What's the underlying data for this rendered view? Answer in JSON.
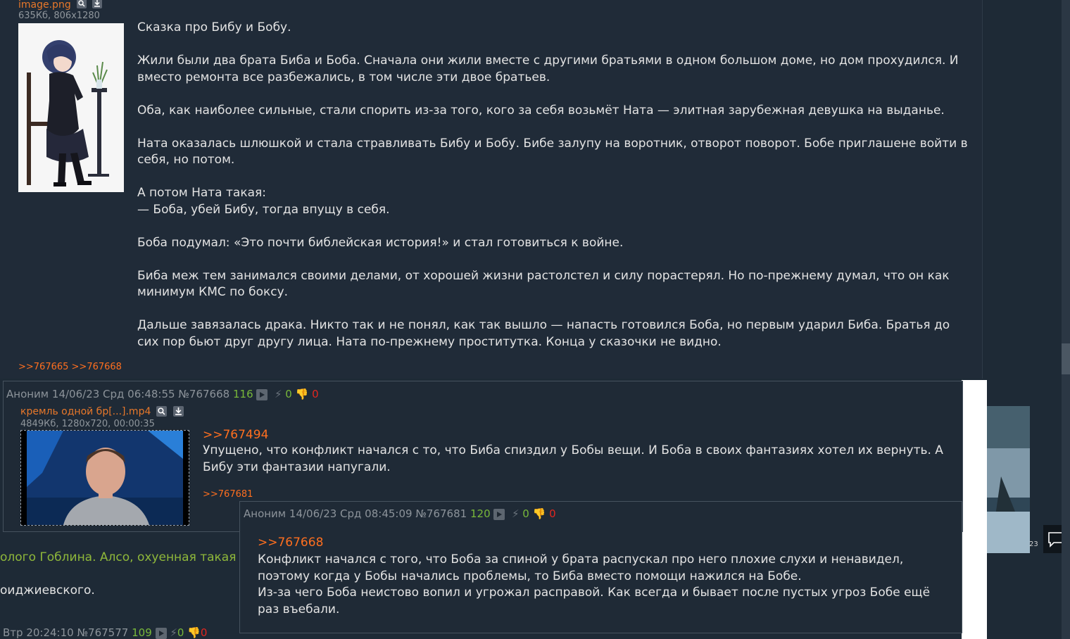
{
  "main_post": {
    "file": {
      "name": "image.png",
      "meta": "635Кб, 806x1280"
    },
    "paragraphs": [
      "Сказка про Бибу и Бобу.",
      "Жили были два брата Биба и Боба. Сначала они жили вместе с другими братьями в одном большом доме, но дом прохудился. И вместо ремонта все разбежались, в том числе эти двое братьев.",
      "Оба, как наиболее сильные, стали спорить из-за того, кого за себя возьмёт Ната — элитная зарубежная девушка на выданье.",
      "Ната оказалась шлюшкой и стала стравливать Бибу и Бобу. Бибе залупу на воротник, отворот поворот. Бобе приглашене войти в себя, но потом.",
      "А потом Ната такая:\n— Боба, убей Бибу, тогда впущу в себя.",
      "Боба подумал: «Это почти библейская история!» и стал готовиться к войне.",
      "Биба меж тем занимался своими делами, от хорошей жизни растолстел и силу порастерял. Но по-прежнему думал, что он как минимум КМС по боксу.",
      "Дальше завязалась драка. Никто так и не понял, как так вышло — напасть готовился Боба, но первым ударил Биба. Братья до сих пор бьют друг другу лица. Ната по-прежнему проститутка. Конца у сказочки не видно."
    ],
    "replies": ">>767665 >>767668"
  },
  "post_767668": {
    "name": "Аноним",
    "date": "14/06/23 Срд 06:48:55",
    "number": "№767668",
    "count": "116",
    "likes": "0",
    "dislikes": "0",
    "file": {
      "name": "кремль одной бр[...].mp4",
      "meta": "4849Кб, 1280x720, 00:00:35"
    },
    "quote": ">>767494",
    "text": "Упущено, что конфликт начался с то, что Биба спиздил у Бобы вещи. И Боба в своих фантазиях хотел их вернуть. А Бибу эти фантазии напугали.",
    "replies": ">>767681"
  },
  "post_767681": {
    "name": "Аноним",
    "date": "14/06/23 Срд 08:45:09",
    "number": "№767681",
    "count": "120",
    "likes": "0",
    "dislikes": "0",
    "quote": ">>767668",
    "text1": "Конфликт начался с того, что Боба за спиной у брата распускал про него плохие слухи и ненавидел, поэтому когда у Бобы начались проблемы, то Биба вместо помощи нажился на Бобе.",
    "text2": "Из-за чего Боба неистово вопил и угрожал расправой. Как всегда и бывает после пустых угроз Бобе ещё раз въебали."
  },
  "background": {
    "text1": "олого Гоблина. Алсо, охуенная такая стр",
    "text2": "оиджиевского.",
    "header_partial": "Втр 20:24:10 №767577",
    "count": "109",
    "likes": "0",
    "dislikes": "0",
    "right_partial": "23"
  },
  "colors": {
    "bg": "#1e2a36",
    "link": "#ff6600",
    "green": "#78b83a",
    "red": "#e2261f"
  }
}
